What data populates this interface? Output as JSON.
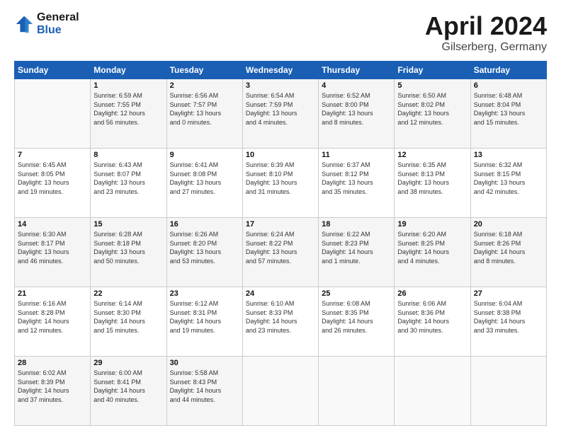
{
  "header": {
    "logo_line1": "General",
    "logo_line2": "Blue",
    "month_title": "April 2024",
    "location": "Gilserberg, Germany"
  },
  "weekdays": [
    "Sunday",
    "Monday",
    "Tuesday",
    "Wednesday",
    "Thursday",
    "Friday",
    "Saturday"
  ],
  "weeks": [
    [
      {
        "num": "",
        "info": ""
      },
      {
        "num": "1",
        "info": "Sunrise: 6:59 AM\nSunset: 7:55 PM\nDaylight: 12 hours\nand 56 minutes."
      },
      {
        "num": "2",
        "info": "Sunrise: 6:56 AM\nSunset: 7:57 PM\nDaylight: 13 hours\nand 0 minutes."
      },
      {
        "num": "3",
        "info": "Sunrise: 6:54 AM\nSunset: 7:59 PM\nDaylight: 13 hours\nand 4 minutes."
      },
      {
        "num": "4",
        "info": "Sunrise: 6:52 AM\nSunset: 8:00 PM\nDaylight: 13 hours\nand 8 minutes."
      },
      {
        "num": "5",
        "info": "Sunrise: 6:50 AM\nSunset: 8:02 PM\nDaylight: 13 hours\nand 12 minutes."
      },
      {
        "num": "6",
        "info": "Sunrise: 6:48 AM\nSunset: 8:04 PM\nDaylight: 13 hours\nand 15 minutes."
      }
    ],
    [
      {
        "num": "7",
        "info": "Sunrise: 6:45 AM\nSunset: 8:05 PM\nDaylight: 13 hours\nand 19 minutes."
      },
      {
        "num": "8",
        "info": "Sunrise: 6:43 AM\nSunset: 8:07 PM\nDaylight: 13 hours\nand 23 minutes."
      },
      {
        "num": "9",
        "info": "Sunrise: 6:41 AM\nSunset: 8:08 PM\nDaylight: 13 hours\nand 27 minutes."
      },
      {
        "num": "10",
        "info": "Sunrise: 6:39 AM\nSunset: 8:10 PM\nDaylight: 13 hours\nand 31 minutes."
      },
      {
        "num": "11",
        "info": "Sunrise: 6:37 AM\nSunset: 8:12 PM\nDaylight: 13 hours\nand 35 minutes."
      },
      {
        "num": "12",
        "info": "Sunrise: 6:35 AM\nSunset: 8:13 PM\nDaylight: 13 hours\nand 38 minutes."
      },
      {
        "num": "13",
        "info": "Sunrise: 6:32 AM\nSunset: 8:15 PM\nDaylight: 13 hours\nand 42 minutes."
      }
    ],
    [
      {
        "num": "14",
        "info": "Sunrise: 6:30 AM\nSunset: 8:17 PM\nDaylight: 13 hours\nand 46 minutes."
      },
      {
        "num": "15",
        "info": "Sunrise: 6:28 AM\nSunset: 8:18 PM\nDaylight: 13 hours\nand 50 minutes."
      },
      {
        "num": "16",
        "info": "Sunrise: 6:26 AM\nSunset: 8:20 PM\nDaylight: 13 hours\nand 53 minutes."
      },
      {
        "num": "17",
        "info": "Sunrise: 6:24 AM\nSunset: 8:22 PM\nDaylight: 13 hours\nand 57 minutes."
      },
      {
        "num": "18",
        "info": "Sunrise: 6:22 AM\nSunset: 8:23 PM\nDaylight: 14 hours\nand 1 minute."
      },
      {
        "num": "19",
        "info": "Sunrise: 6:20 AM\nSunset: 8:25 PM\nDaylight: 14 hours\nand 4 minutes."
      },
      {
        "num": "20",
        "info": "Sunrise: 6:18 AM\nSunset: 8:26 PM\nDaylight: 14 hours\nand 8 minutes."
      }
    ],
    [
      {
        "num": "21",
        "info": "Sunrise: 6:16 AM\nSunset: 8:28 PM\nDaylight: 14 hours\nand 12 minutes."
      },
      {
        "num": "22",
        "info": "Sunrise: 6:14 AM\nSunset: 8:30 PM\nDaylight: 14 hours\nand 15 minutes."
      },
      {
        "num": "23",
        "info": "Sunrise: 6:12 AM\nSunset: 8:31 PM\nDaylight: 14 hours\nand 19 minutes."
      },
      {
        "num": "24",
        "info": "Sunrise: 6:10 AM\nSunset: 8:33 PM\nDaylight: 14 hours\nand 23 minutes."
      },
      {
        "num": "25",
        "info": "Sunrise: 6:08 AM\nSunset: 8:35 PM\nDaylight: 14 hours\nand 26 minutes."
      },
      {
        "num": "26",
        "info": "Sunrise: 6:06 AM\nSunset: 8:36 PM\nDaylight: 14 hours\nand 30 minutes."
      },
      {
        "num": "27",
        "info": "Sunrise: 6:04 AM\nSunset: 8:38 PM\nDaylight: 14 hours\nand 33 minutes."
      }
    ],
    [
      {
        "num": "28",
        "info": "Sunrise: 6:02 AM\nSunset: 8:39 PM\nDaylight: 14 hours\nand 37 minutes."
      },
      {
        "num": "29",
        "info": "Sunrise: 6:00 AM\nSunset: 8:41 PM\nDaylight: 14 hours\nand 40 minutes."
      },
      {
        "num": "30",
        "info": "Sunrise: 5:58 AM\nSunset: 8:43 PM\nDaylight: 14 hours\nand 44 minutes."
      },
      {
        "num": "",
        "info": ""
      },
      {
        "num": "",
        "info": ""
      },
      {
        "num": "",
        "info": ""
      },
      {
        "num": "",
        "info": ""
      }
    ]
  ]
}
